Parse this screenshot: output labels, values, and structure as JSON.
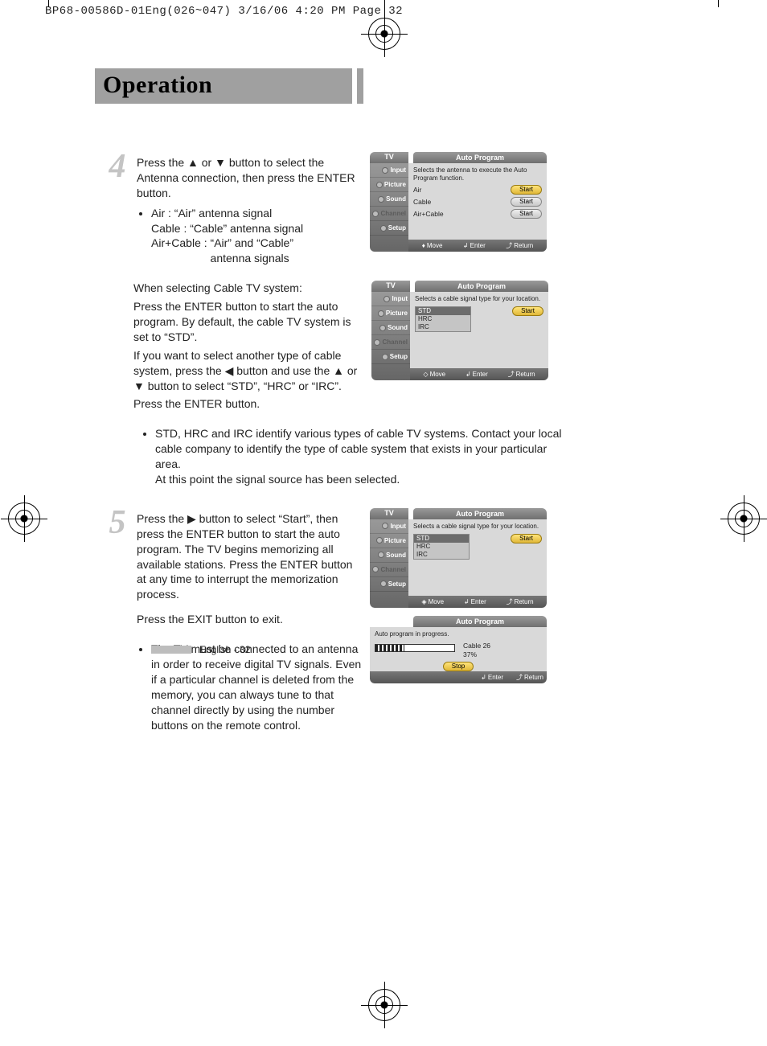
{
  "print_header": "BP68-00586D-01Eng(026~047)  3/16/06  4:20 PM  Page 32",
  "title": "Operation",
  "step4": {
    "num": "4",
    "p1": "Press the ▲ or ▼ button to select the Antenna connection, then press the ENTER button.",
    "li_air": "Air : “Air” antenna signal",
    "li_cable": "Cable : “Cable” antenna signal",
    "li_aircable_a": "Air+Cable : “Air” and “Cable”",
    "li_aircable_b": "antenna signals",
    "p2a": "When selecting Cable TV system:",
    "p2b": "Press the ENTER button to start the auto program. By default, the cable TV system is set to “STD”.",
    "p2c": "If you want to select another type of cable system, press the ◀ button and use the ▲ or ▼ button to select “STD”, “HRC” or “IRC”.",
    "p2d": "Press the ENTER button.",
    "note": "STD, HRC and IRC identify various types of cable TV systems. Contact your local cable company to identify the type of cable system that exists in your particular area.",
    "note2": "At this point the signal source has been selected."
  },
  "step5": {
    "num": "5",
    "p1": "Press the ▶ button to select “Start”, then press the ENTER button to start the auto program. The TV begins memorizing all available stations. Press the ENTER button at any time to interrupt the memorization process.",
    "p2": "Press the EXIT button to exit.",
    "note": "The TV must be connected to an antenna in order to receive digital TV signals. Even if a particular channel is deleted from the memory, you can always tune to that channel directly by using the number buttons on the remote control."
  },
  "osd": {
    "tv": "TV",
    "title": "Auto Program",
    "sidebar": {
      "input": "Input",
      "picture": "Picture",
      "sound": "Sound",
      "channel": "Channel",
      "setup": "Setup"
    },
    "panel1": {
      "desc": "Selects the antenna to execute the Auto Program function.",
      "air": "Air",
      "cable": "Cable",
      "aircable": "Air+Cable",
      "start": "Start"
    },
    "panel2": {
      "desc": "Selects a cable signal type for your location.",
      "std": "STD",
      "hrc": "HRC",
      "irc": "IRC",
      "start": "Start"
    },
    "panel3": {
      "desc": "Selects a cable signal type for your location.",
      "start": "Start"
    },
    "panel4": {
      "desc": "Auto program in progress.",
      "channel_label": "Cable 26",
      "percent": "37%",
      "stop": "Stop"
    },
    "footer": {
      "move_ud": "Move",
      "move_lr": "Move",
      "enter": "Enter",
      "return": "Return"
    }
  },
  "footer_page": "English - 32"
}
